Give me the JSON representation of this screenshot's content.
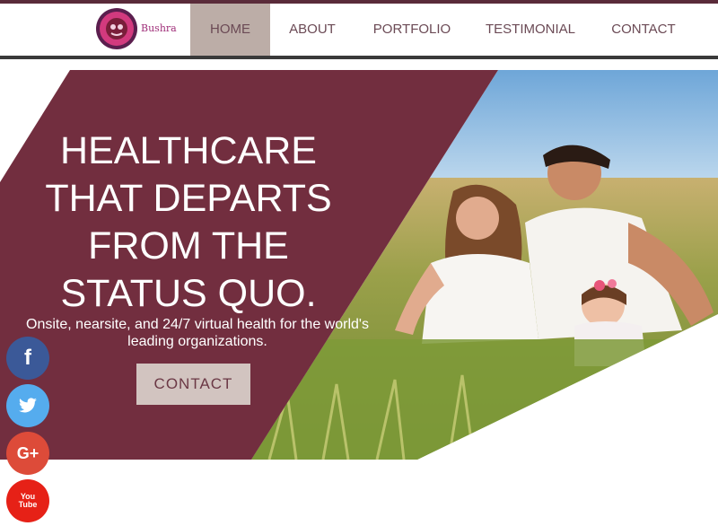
{
  "brand": {
    "name": "Bushra"
  },
  "nav": {
    "items": [
      {
        "label": "HOME",
        "active": true
      },
      {
        "label": "ABOUT",
        "active": false
      },
      {
        "label": "PORTFOLIO",
        "active": false
      },
      {
        "label": "TESTIMONIAL",
        "active": false
      },
      {
        "label": "CONTACT",
        "active": false
      }
    ]
  },
  "hero": {
    "headline_lines": [
      "HEALTHCARE",
      "THAT DEPARTS",
      "FROM THE",
      "STATUS QUO."
    ],
    "subtext": "Onsite, nearsite, and 24/7 virtual health for the world's leading organizations.",
    "cta_label": "CONTACT"
  },
  "social": [
    {
      "icon": "facebook-icon",
      "glyph": "f",
      "color": "#3b5998"
    },
    {
      "icon": "twitter-icon",
      "glyph": "",
      "color": "#55acee"
    },
    {
      "icon": "google-plus-icon",
      "glyph": "G+",
      "color": "#dd4b39"
    },
    {
      "icon": "youtube-icon",
      "glyph": "You Tube",
      "color": "#e62117"
    }
  ],
  "colors": {
    "accent": "#722e3f",
    "nav_active": "#bcada7",
    "cta_bg": "#d2c4c0"
  }
}
